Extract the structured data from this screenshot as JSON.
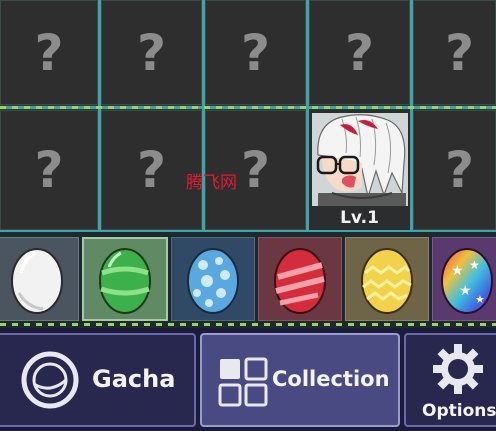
{
  "grid": {
    "unknown_mark": "?",
    "character": {
      "level": "Lv.1"
    }
  },
  "watermark": "腾飞网",
  "eggs": [
    {
      "name": "white-egg",
      "bg": "#4a5560",
      "color": "#f2f2f2"
    },
    {
      "name": "green-striped-egg",
      "bg": "#5f8a63",
      "color": "#3cb04a"
    },
    {
      "name": "blue-spotted-egg",
      "bg": "#304a66",
      "color": "#5aa8e0"
    },
    {
      "name": "red-striped-egg",
      "bg": "#6a3742",
      "color": "#d42c3c"
    },
    {
      "name": "yellow-zigzag-egg",
      "bg": "#6e6448",
      "color": "#f2d24a"
    },
    {
      "name": "rainbow-star-egg",
      "bg": "#5a3a6e",
      "color": "#e04ac0"
    }
  ],
  "nav": {
    "gacha": "Gacha",
    "collection": "Collection",
    "options": "Options"
  }
}
